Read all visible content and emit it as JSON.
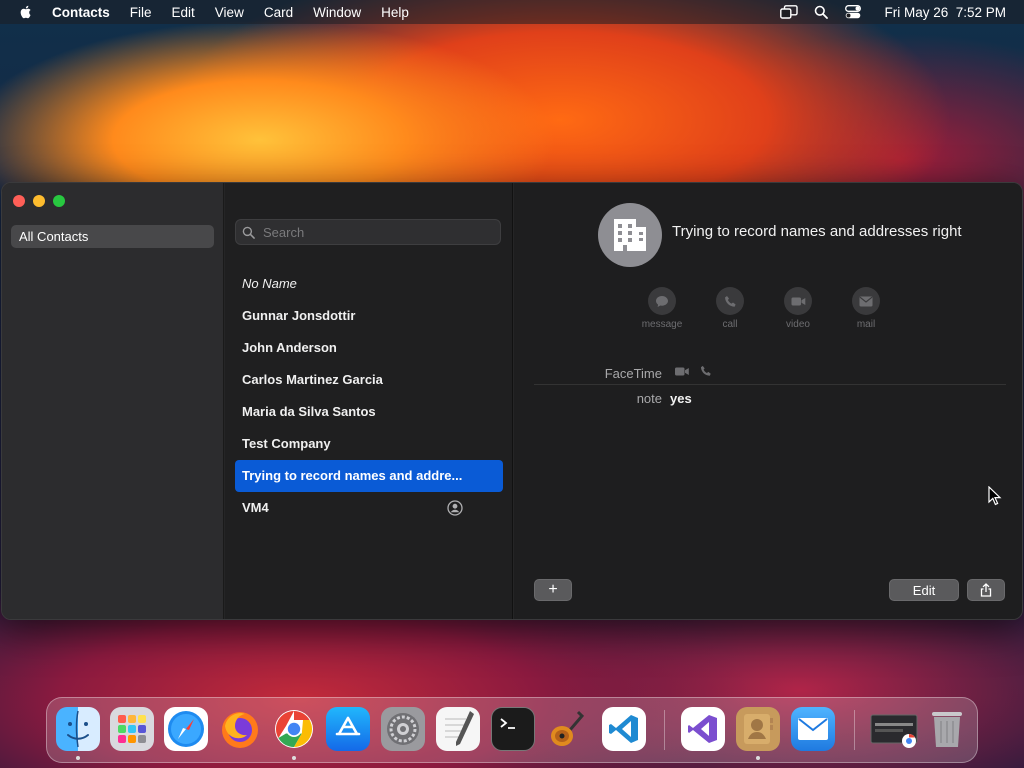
{
  "menubar": {
    "app_name": "Contacts",
    "items": [
      "File",
      "Edit",
      "View",
      "Card",
      "Window",
      "Help"
    ],
    "clock": "Fri May 26  7:52 PM"
  },
  "sidebar": {
    "groups": [
      {
        "label": "All Contacts",
        "selected": true
      }
    ]
  },
  "list": {
    "search_placeholder": "Search",
    "contacts": [
      {
        "name": "No Name"
      },
      {
        "name": "Gunnar Jonsdottir"
      },
      {
        "name": "John Anderson"
      },
      {
        "name": "Carlos Martinez Garcia"
      },
      {
        "name": "Maria da Silva Santos"
      },
      {
        "name": "Test Company"
      },
      {
        "name": "Trying to record names and addre..."
      },
      {
        "name": "VM4"
      }
    ]
  },
  "detail": {
    "name": "Trying to record names and addresses right",
    "actions": [
      "message",
      "call",
      "video",
      "mail"
    ],
    "fields": {
      "facetime_label": "FaceTime",
      "note_label": "note",
      "note_value": "yes"
    },
    "add_symbol": "+",
    "edit_label": "Edit"
  },
  "colors": {
    "selection": "#0a5bd6",
    "close": "#ff5f57",
    "minimize": "#febc2e",
    "maximize": "#28c840"
  },
  "dock": {
    "apps": [
      "finder",
      "launchpad",
      "safari",
      "firefox",
      "chrome",
      "app-store",
      "system-settings",
      "textedit",
      "terminal",
      "garageband",
      "vscode",
      "visual-studio",
      "contacts",
      "mail",
      "chrome-window",
      "trash"
    ]
  }
}
